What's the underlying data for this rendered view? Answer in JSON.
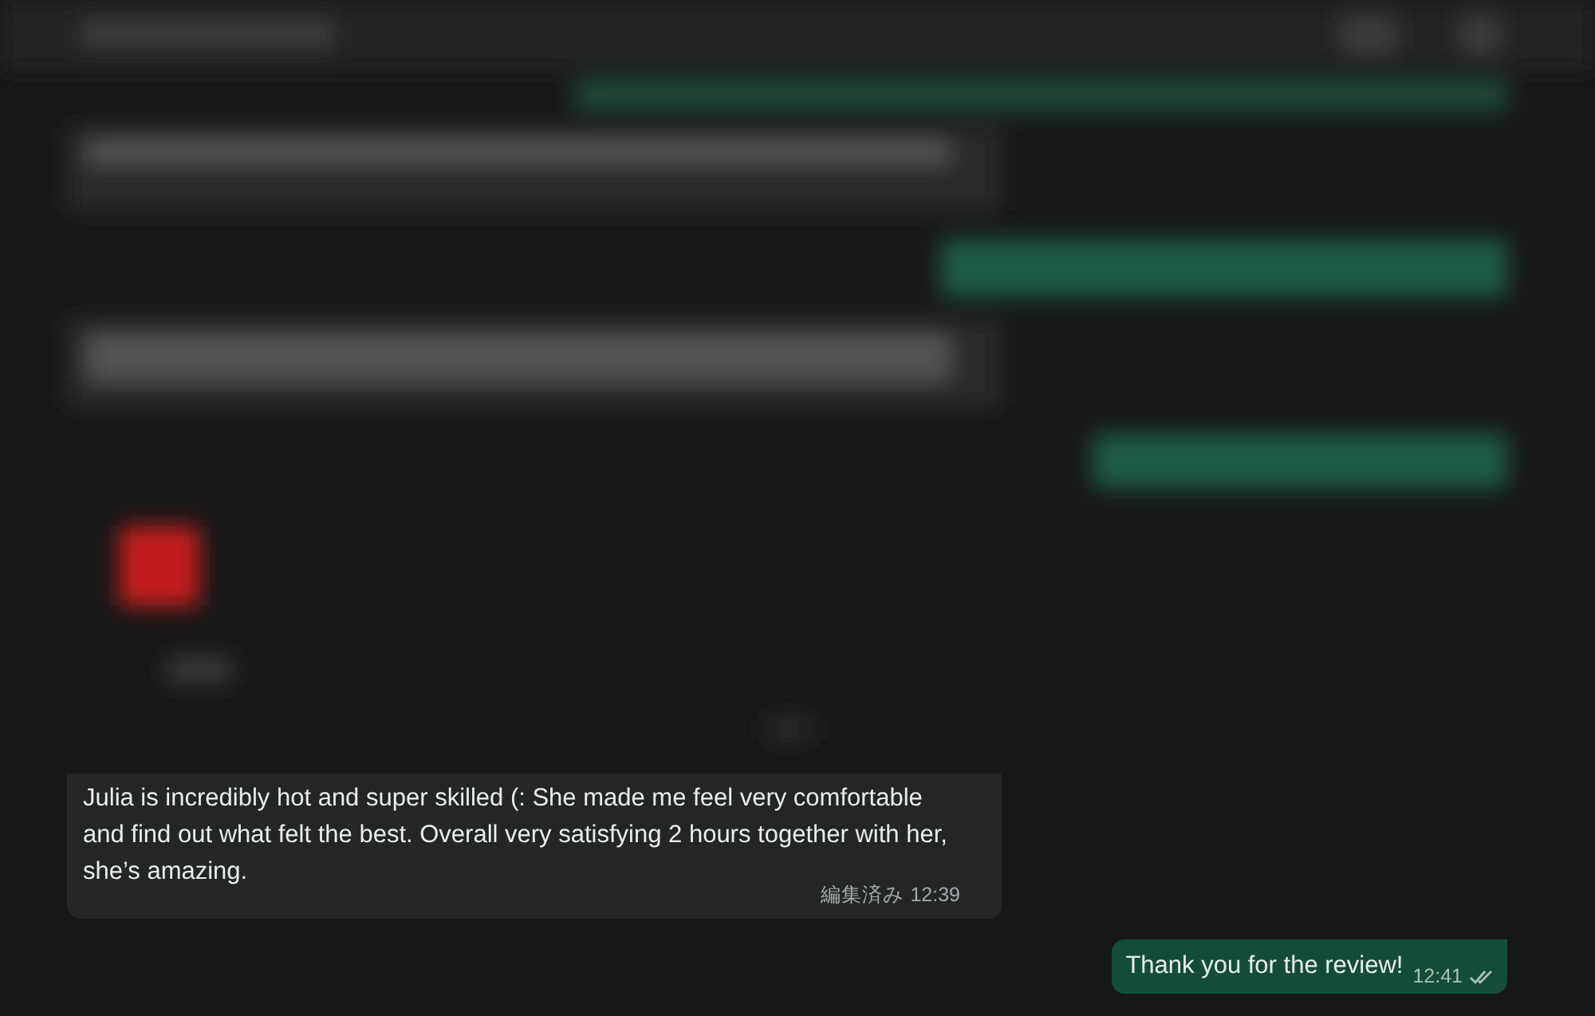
{
  "messages": [
    {
      "kind": "incoming",
      "text": "Julia is incredibly hot and super skilled (: She made me feel very comfortable and find out what felt the best. Overall very satisfying 2 hours together with her, she’s amazing.",
      "edited": "編集済み",
      "time": "12:39"
    },
    {
      "kind": "outgoing",
      "text": "Thank you for the review!",
      "time": "12:41",
      "read": false
    }
  ]
}
